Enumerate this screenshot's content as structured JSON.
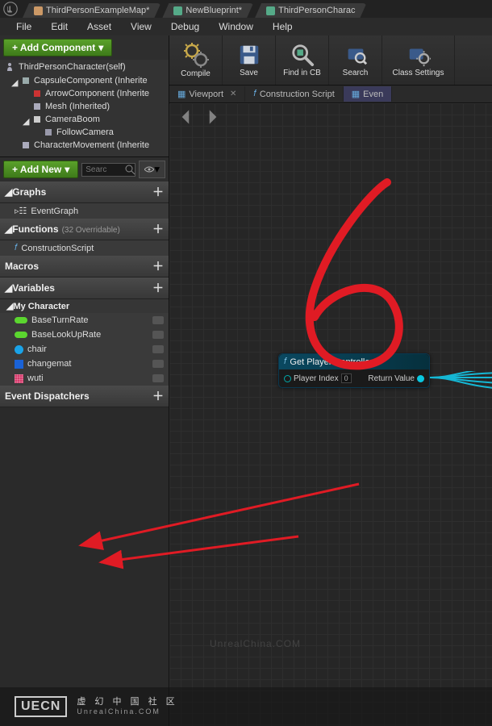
{
  "topTabs": [
    "ThirdPersonExampleMap*",
    "NewBlueprint*",
    "ThirdPersonCharac"
  ],
  "menu": [
    "File",
    "Edit",
    "Asset",
    "View",
    "Debug",
    "Window",
    "Help"
  ],
  "addComponent": "+ Add Component",
  "selfRow": "ThirdPersonCharacter(self)",
  "componentTree": [
    {
      "label": "CapsuleComponent (Inherite",
      "indent": 1,
      "arrow": true,
      "iconColor": "#9aa"
    },
    {
      "label": "ArrowComponent (Inherite",
      "indent": 2,
      "arrow": false,
      "iconColor": "#c33"
    },
    {
      "label": "Mesh (Inherited)",
      "indent": 2,
      "arrow": false,
      "iconColor": "#aab"
    },
    {
      "label": "CameraBoom",
      "indent": 2,
      "arrow": true,
      "iconColor": "#ccc"
    },
    {
      "label": "FollowCamera",
      "indent": 3,
      "arrow": false,
      "iconColor": "#99a"
    },
    {
      "label": "CharacterMovement (Inherite",
      "indent": 1,
      "arrow": false,
      "iconColor": "#aab"
    }
  ],
  "addNew": "+ Add New",
  "searchPlaceholder": "Searc",
  "sections": {
    "graphs": {
      "title": "Graphs",
      "items": [
        "EventGraph"
      ]
    },
    "functions": {
      "title": "Functions",
      "sub": "(32 Overridable)",
      "items": [
        "ConstructionScript"
      ]
    },
    "macros": {
      "title": "Macros"
    },
    "variables": {
      "title": "Variables",
      "sub": "My Character",
      "items": [
        {
          "name": "BaseTurnRate",
          "type": "pill",
          "color": "#5bd62f"
        },
        {
          "name": "BaseLookUpRate",
          "type": "pill",
          "color": "#5bd62f"
        },
        {
          "name": "chair",
          "type": "circle",
          "color": "#1aa3e8"
        },
        {
          "name": "changemat",
          "type": "square",
          "color": "#1a62d6"
        },
        {
          "name": "wuti",
          "type": "grid",
          "color": "#d63a6b"
        }
      ]
    },
    "eventDispatchers": {
      "title": "Event Dispatchers"
    }
  },
  "toolbar": [
    {
      "label": "Compile",
      "icon": "compile"
    },
    {
      "label": "Save",
      "icon": "save"
    },
    {
      "label": "Find in CB",
      "icon": "find"
    },
    {
      "label": "Search",
      "icon": "search"
    },
    {
      "label": "Class Settings",
      "icon": "settings"
    }
  ],
  "subTabs": [
    {
      "label": "Viewport",
      "icon": "grid",
      "active": false,
      "closable": true
    },
    {
      "label": "Construction Script",
      "icon": "fx",
      "active": false,
      "closable": false
    },
    {
      "label": "Even",
      "icon": "grid",
      "active": true,
      "closable": false
    }
  ],
  "node": {
    "title": "Get Player Controller",
    "inputPin": "Player Index",
    "inputValue": "0",
    "outputPin": "Return Value"
  },
  "watermark": {
    "bg": "UnrealChina.COM",
    "logo": "UECN",
    "line1": "虚 幻 中 国 社 区",
    "line2": "UnrealChina.COM"
  }
}
